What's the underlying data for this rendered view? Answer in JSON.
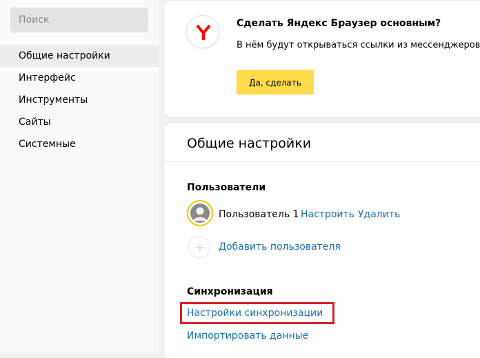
{
  "sidebar": {
    "search_placeholder": "Поиск",
    "items": [
      {
        "label": "Общие настройки",
        "active": true
      },
      {
        "label": "Интерфейс"
      },
      {
        "label": "Инструменты"
      },
      {
        "label": "Сайты"
      },
      {
        "label": "Системные"
      }
    ]
  },
  "promo": {
    "icon": "yandex-browser-logo",
    "title": "Сделать Яндекс Браузер основным?",
    "text": "В нём будут открываться ссылки из мессенджеров,",
    "button": "Да, сделать",
    "button_color": "#ffdb4d"
  },
  "settings": {
    "title": "Общие настройки",
    "users": {
      "heading": "Пользователи",
      "user_name": "Пользователь 1",
      "configure": "Настроить",
      "remove": "Удалить",
      "add_user": "Добавить пользователя"
    },
    "sync": {
      "heading": "Синхронизация",
      "sync_settings": "Настройки синхронизации",
      "import": "Импортировать данные",
      "highlight_color": "#d41f26"
    },
    "link_color": "#1a6fb5"
  }
}
